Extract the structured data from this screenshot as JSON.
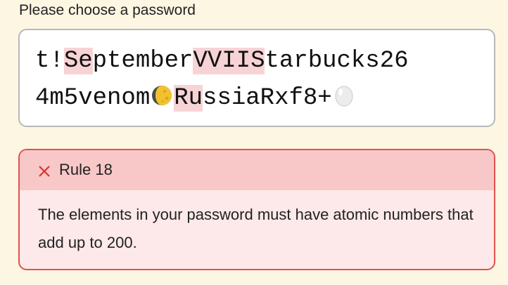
{
  "prompt": {
    "label": "Please choose a password"
  },
  "password": {
    "line1": [
      {
        "text": "t!",
        "highlight": false
      },
      {
        "text": "Se",
        "highlight": true
      },
      {
        "text": "ptember",
        "highlight": false
      },
      {
        "text": "VVIIS",
        "highlight": true
      },
      {
        "text": "tarbucks26",
        "highlight": false
      }
    ],
    "line2_before_moon": "4m5venom",
    "moon_icon": "waning-gibbous-moon-icon",
    "line2_highlight": "Ru",
    "line2_after": "ssiaRxf8+",
    "egg_icon": "egg-icon",
    "highlight_color": "#f8d3d6"
  },
  "rule": {
    "icon": "close-icon",
    "title": "Rule 18",
    "text": "The elements in your password must have atomic numbers that add up to 200.",
    "border_color": "#e0524f",
    "header_color": "#f8c7c7",
    "body_color": "#fde9e9"
  }
}
